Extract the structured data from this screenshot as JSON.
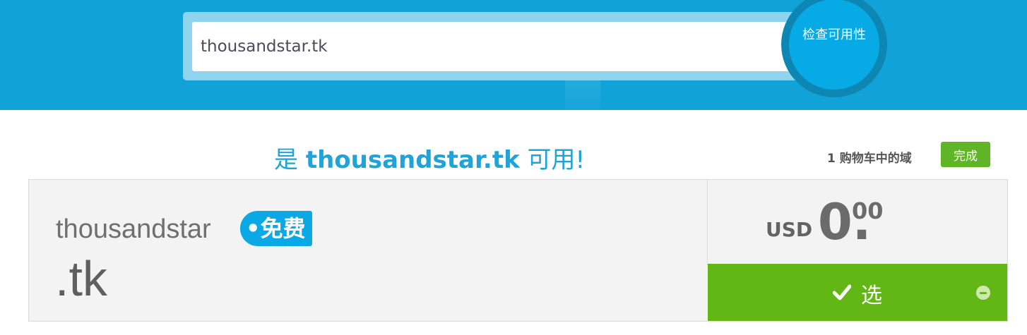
{
  "search": {
    "value": "thousandstar.tk",
    "check_button_label": "检查可用性"
  },
  "result": {
    "title_prefix": "是",
    "title_domain": "thousandstar.tk",
    "title_suffix": "可用!",
    "cart_text": "1 购物车中的域",
    "done_label": "完成",
    "domain_name": "thousandstar",
    "free_badge": "•免费",
    "tld": ".tk",
    "currency": "USD",
    "price_integer": "0.",
    "price_decimal": "00",
    "select_label": "选"
  },
  "colors": {
    "header_blue": "#11a3d8",
    "accent_blue": "#1fa3d8",
    "green": "#62b615"
  },
  "icons": [
    "check-icon",
    "minus-circle-icon"
  ]
}
